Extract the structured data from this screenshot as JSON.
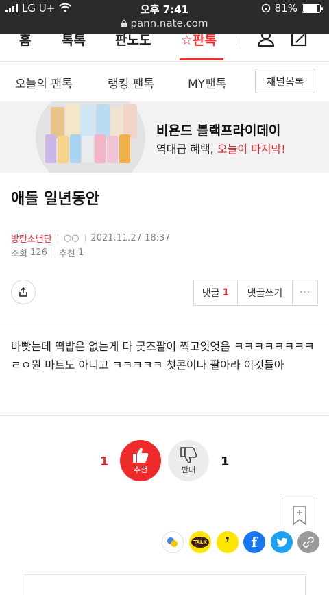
{
  "status_bar": {
    "carrier": "LG U+",
    "time": "오후 7:41",
    "battery": "81%",
    "url": "pann.nate.com"
  },
  "gnb": {
    "items": [
      "홈",
      "톡톡",
      "판노도",
      "☆판톡"
    ]
  },
  "subnav": {
    "items": [
      "오늘의 팬톡",
      "랭킹 팬톡",
      "MY팬톡"
    ],
    "channel_button": "채널목록"
  },
  "banner": {
    "title": "비욘드 블랙프라이데이",
    "sub_prefix": "역대급 혜택, ",
    "sub_highlight": "오늘이 마지막!"
  },
  "post": {
    "title": "애들 일년동안",
    "channel": "방탄소년단",
    "author": "○○",
    "datetime": "2021.11.27 18:37",
    "views_label": "조회",
    "views": "126",
    "recommend_label": "추천",
    "recommend": "1",
    "content": "바빳는데 떡밥은 없는게 다 굿즈팔이 찍고잇엇음 ㅋㅋㅋㅋㅋㅋㅋㅋ ㄹㅇ뭔 마트도 아니고 ㅋㅋㅋㅋㅋ 첫콘이나 팔아라 이것들아"
  },
  "actions": {
    "comments_label": "댓글",
    "comments_count": "1",
    "write_comment": "댓글쓰기",
    "more": "···"
  },
  "vote": {
    "up_count": "1",
    "up_label": "추천",
    "down_label": "반대",
    "down_count": "1"
  },
  "sns": {
    "kakaotalk": "TALK",
    "kakaostory": "❜"
  },
  "colors": {
    "accent": "#ff2a2a",
    "status_bar_bg": "#2b2b2b",
    "kakao_yellow": "#fee500",
    "facebook": "#1877f2",
    "twitter": "#1da1f2",
    "link_gray": "#9a9a9a"
  },
  "icons": [
    "wifi-icon",
    "lock-icon",
    "orientation-lock-icon",
    "battery-icon",
    "user-icon",
    "write-icon",
    "share-icon",
    "thumbs-up-icon",
    "thumbs-down-icon",
    "bookmark-add-icon",
    "kakao-band-icon",
    "kakaotalk-icon",
    "kakaostory-icon",
    "facebook-icon",
    "twitter-icon",
    "link-icon"
  ]
}
